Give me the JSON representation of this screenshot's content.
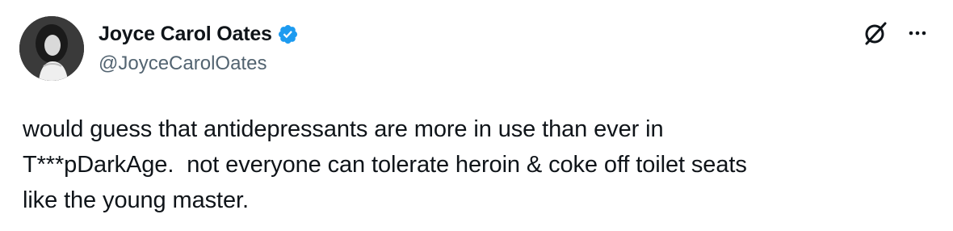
{
  "author": {
    "display_name": "Joyce Carol Oates",
    "handle": "@JoyceCarolOates",
    "verified": true,
    "avatar_icon": "author-avatar"
  },
  "actions": {
    "grok_icon": "grok-icon",
    "more_icon": "more-options-icon"
  },
  "tweet": {
    "lines": [
      "would guess that antidepressants are more in use than ever in",
      "T***pDarkAge.  not everyone can tolerate heroin & coke off toilet seats",
      "like the young master."
    ]
  },
  "colors": {
    "text": "#0f1419",
    "secondary": "#536471",
    "verified_badge": "#1d9bf0"
  }
}
